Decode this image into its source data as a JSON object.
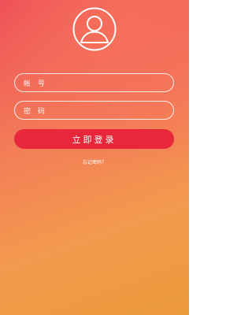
{
  "avatar": {
    "icon": "user-icon"
  },
  "form": {
    "account_placeholder": "帐 号",
    "account_value": "",
    "password_placeholder": "密 码",
    "password_value": "",
    "login_label": "立即登录",
    "forgot_label": "忘记密码？"
  },
  "colors": {
    "button": "#e8283a",
    "gradient_top": "#ef4f59",
    "gradient_bottom": "#eb9a3a",
    "text": "#ffffff"
  }
}
